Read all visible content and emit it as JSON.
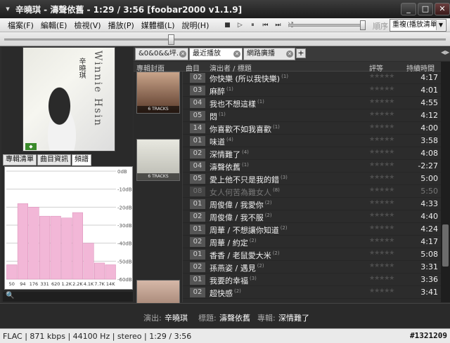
{
  "window": {
    "title": "辛曉琪 - 濤聲依舊 - 1:29 / 3:56  [foobar2000 v1.1.9]",
    "buttons": [
      "▾",
      "_",
      "□",
      "✕"
    ]
  },
  "menu": {
    "items": [
      "檔案(F)",
      "編輯(E)",
      "檢視(V)",
      "播放(P)",
      "媒體櫃(L)",
      "說明(H)"
    ],
    "toolbar_icons": [
      "stop-icon",
      "play-icon",
      "pause-icon",
      "previous-icon",
      "next-icon",
      "random-icon"
    ],
    "toolbar_glyphs": [
      "■",
      "▷",
      "⏸",
      "⏮",
      "⏭",
      "⤮"
    ],
    "order_label": "順序",
    "order_value": "重複(播放清單)"
  },
  "seek": {
    "position": "1:29",
    "length": "3:56",
    "progress_fraction": 0.377
  },
  "left_panel": {
    "cover_script": "Winnie Hsin",
    "cover_name": "辛曉琪",
    "tabs": [
      "專輯清單",
      "曲目資訊",
      "頻譜"
    ],
    "active_tab": 2,
    "search_icon": "magnifier-icon"
  },
  "playlist": {
    "tabs": [
      {
        "label": "&0&0&&坪...",
        "active": false
      },
      {
        "label": "最近播放",
        "active": true
      },
      {
        "label": "網路廣播",
        "active": false
      }
    ],
    "add_tab": "+",
    "columns": [
      "專輯封面",
      "曲目",
      "演出者 / 標題",
      "評等",
      "持續時間"
    ],
    "album_arts": [
      {
        "tracks": "6 TRACKS",
        "top": 0
      },
      {
        "tracks": "6 TRACKS",
        "top": 1
      },
      {
        "tracks": "",
        "top": 2
      }
    ],
    "rows": [
      {
        "num": "02",
        "title": "你快樂 (所以我快樂)",
        "sup": "(1)",
        "dur": "4:17",
        "dim": false
      },
      {
        "num": "03",
        "title": "麻醉",
        "sup": "(1)",
        "dur": "4:01",
        "dim": false
      },
      {
        "num": "04",
        "title": "我也不想這樣",
        "sup": "(1)",
        "dur": "4:55",
        "dim": false
      },
      {
        "num": "05",
        "title": "悶",
        "sup": "(1)",
        "dur": "4:12",
        "dim": false
      },
      {
        "num": "14",
        "title": "你喜歡不如我喜歡",
        "sup": "(1)",
        "dur": "4:00",
        "dim": false
      },
      {
        "num": "01",
        "title": "味道",
        "sup": "(4)",
        "dur": "3:58",
        "dim": false
      },
      {
        "num": "02",
        "title": "深情難了",
        "sup": "(4)",
        "dur": "4:08",
        "dim": false
      },
      {
        "num": "04",
        "title": "濤聲依舊",
        "sup": "(1)",
        "dur": "-2:27",
        "dim": false
      },
      {
        "num": "05",
        "title": "愛上他不只是我的錯",
        "sup": "(3)",
        "dur": "5:00",
        "dim": false
      },
      {
        "num": "08",
        "title": "女人何苦為難女人",
        "sup": "(8)",
        "dur": "5:50",
        "dim": true
      },
      {
        "num": "01",
        "title": "周俊偉 / 我愛你",
        "sup": "(2)",
        "dur": "4:33",
        "dim": false
      },
      {
        "num": "02",
        "title": "周俊偉 / 我不服",
        "sup": "(2)",
        "dur": "4:40",
        "dim": false
      },
      {
        "num": "01",
        "title": "周華 / 不想讓你知道",
        "sup": "(2)",
        "dur": "4:24",
        "dim": false
      },
      {
        "num": "02",
        "title": "周華 / 約定",
        "sup": "(2)",
        "dur": "4:17",
        "dim": false
      },
      {
        "num": "01",
        "title": "香香 / 老鼠愛大米",
        "sup": "(2)",
        "dur": "5:08",
        "dim": false
      },
      {
        "num": "02",
        "title": "孫燕姿 / 遇見",
        "sup": "(2)",
        "dur": "3:31",
        "dim": false
      },
      {
        "num": "01",
        "title": "我要的幸福",
        "sup": "(3)",
        "dur": "3:36",
        "dim": false
      },
      {
        "num": "02",
        "title": "超快感",
        "sup": "(2)",
        "dur": "3:41",
        "dim": false
      }
    ]
  },
  "info": {
    "artist_label": "演出:",
    "artist": "辛曉琪",
    "title_label": "標題:",
    "title": "濤聲依舊",
    "album_label": "專輯:",
    "album": "深情難了"
  },
  "status": {
    "text": "FLAC | 871 kbps | 44100 Hz | stereo | 1:29 / 3:56",
    "watermark": "#1321209"
  },
  "chart_data": {
    "type": "bar",
    "categories": [
      "50",
      "94",
      "176",
      "331",
      "620",
      "1.2K",
      "2.2K",
      "4.1K",
      "7.7K",
      "14K"
    ],
    "values": [
      -52,
      -18,
      -20,
      -25,
      -25,
      -26,
      -23,
      -40,
      -51,
      -52
    ],
    "ylabels": [
      "0dB",
      "-10dB",
      "-20dB",
      "-30dB",
      "-40dB",
      "-50dB",
      "-60dB"
    ],
    "ylim": [
      -60,
      0
    ],
    "color": "#f2b7d7"
  }
}
